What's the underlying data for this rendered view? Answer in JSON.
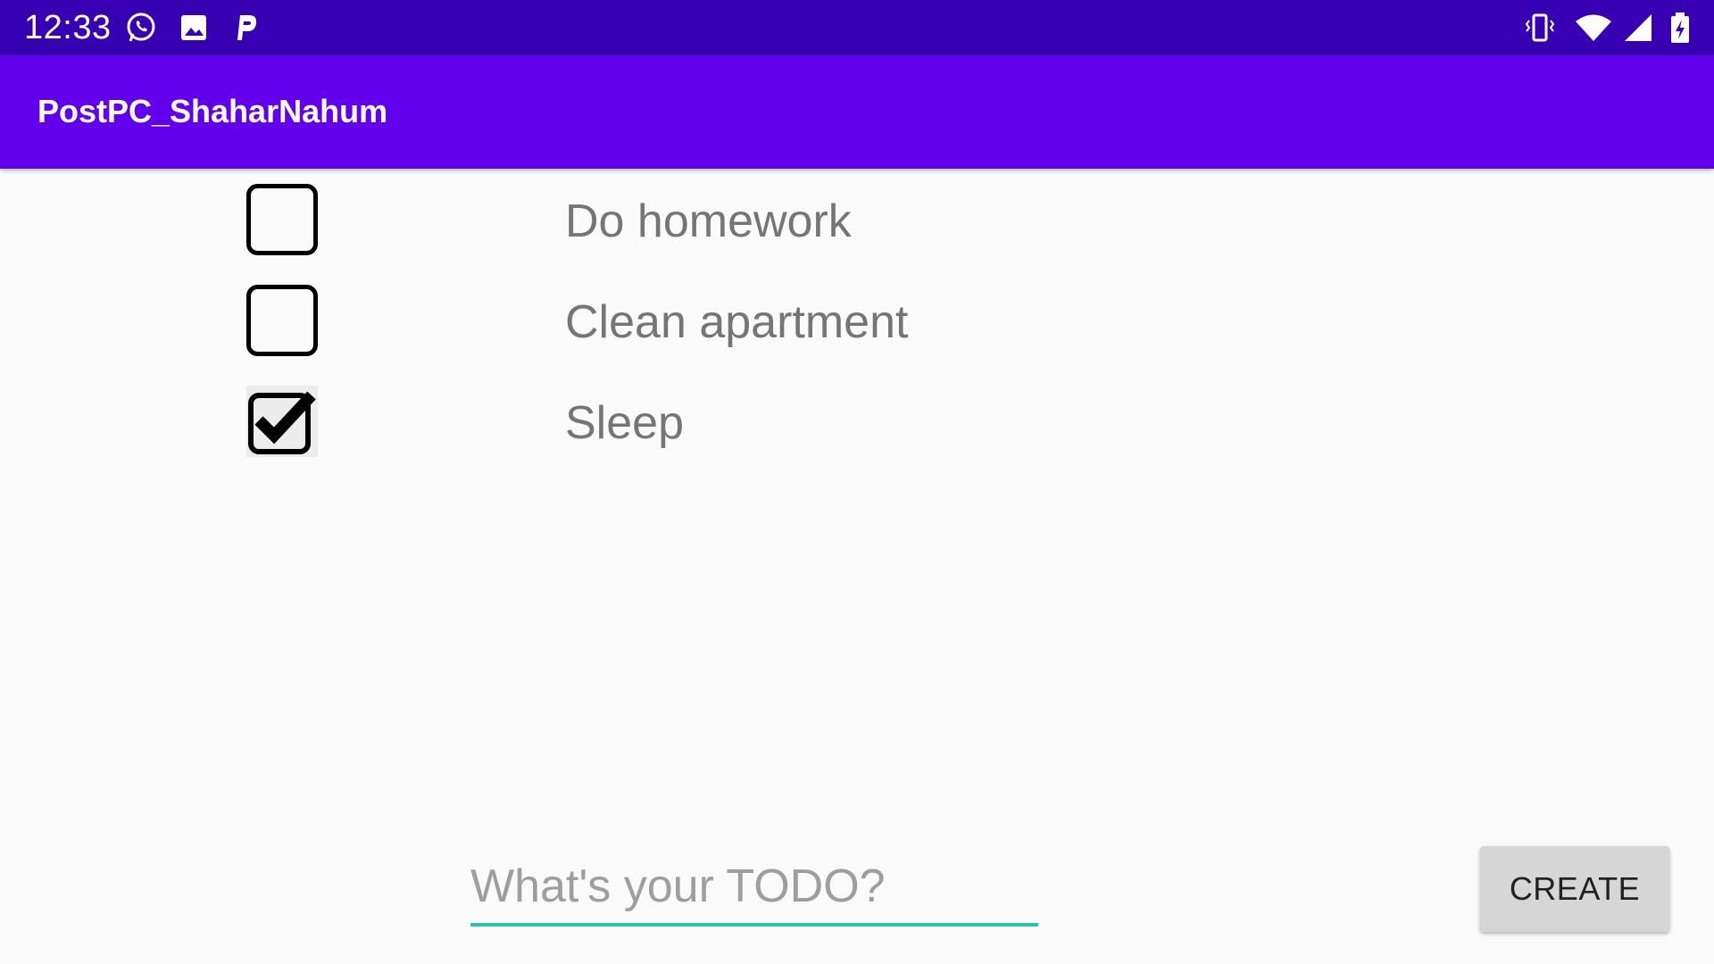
{
  "status_bar": {
    "time": "12:33",
    "left_icons": [
      "whatsapp-icon",
      "gallery-icon",
      "parking-icon"
    ],
    "right_icons": [
      "vibrate-icon",
      "wifi-icon",
      "cell-signal-icon",
      "battery-charging-icon"
    ]
  },
  "app_bar": {
    "title": "PostPC_ShaharNahum",
    "color": "#6200ee",
    "status_bar_color": "#3700b3"
  },
  "todos": [
    {
      "text": "Do homework",
      "checked": false
    },
    {
      "text": "Clean apartment",
      "checked": false
    },
    {
      "text": "Sleep",
      "checked": true
    }
  ],
  "input": {
    "placeholder": "What's your TODO?",
    "value": "",
    "underline_color": "#26c6b4"
  },
  "create_button": {
    "label": "CREATE"
  }
}
